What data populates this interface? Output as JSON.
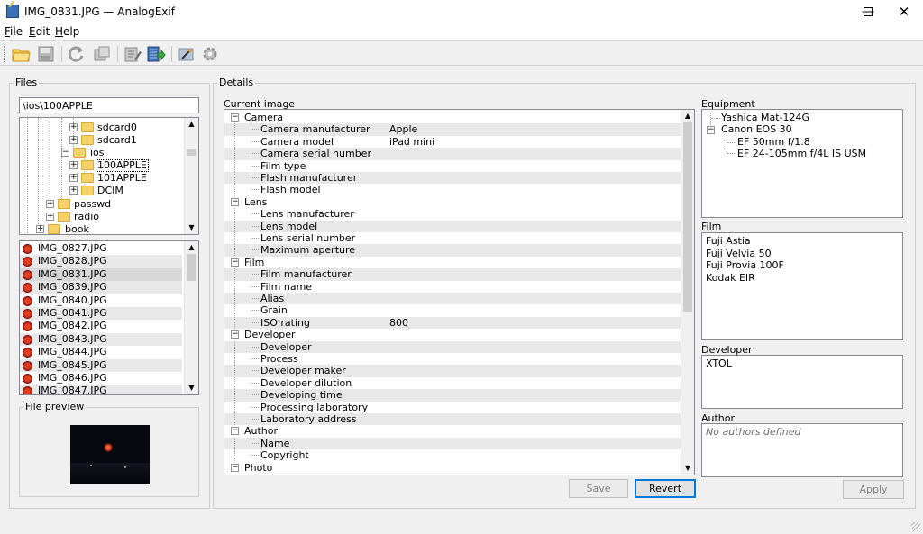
{
  "window": {
    "title": "IMG_0831.JPG — AnalogExif",
    "min_glyph": "—",
    "max_glyph": "☐",
    "close_glyph": "✕"
  },
  "menu": [
    {
      "label": "File",
      "accel": "F",
      "rest": "ile"
    },
    {
      "label": "Edit",
      "accel": "E",
      "rest": "dit"
    },
    {
      "label": "Help",
      "accel": "H",
      "rest": "elp"
    }
  ],
  "toolbar": {
    "icons": [
      "open-folder-icon",
      "save-icon",
      "reload-icon",
      "revert-icon",
      "edit-tags-icon",
      "copy-to-files-icon",
      "gear-equipment-icon",
      "settings-icon"
    ]
  },
  "files_panel": {
    "group_label": "Files",
    "path": "\\ios\\100APPLE",
    "tree": [
      {
        "label": "sdcard0",
        "expander": "+"
      },
      {
        "label": "sdcard1",
        "expander": "+"
      },
      {
        "label": "ios",
        "expander": "−"
      },
      {
        "label": "100APPLE",
        "expander": "+"
      },
      {
        "label": "101APPLE",
        "expander": "+"
      },
      {
        "label": "DCIM",
        "expander": "+"
      },
      {
        "label": "passwd",
        "expander": "+"
      },
      {
        "label": "radio",
        "expander": "+"
      },
      {
        "label": "book",
        "expander": "+"
      }
    ],
    "files": [
      "IMG_0827.JPG",
      "IMG_0828.JPG",
      "IMG_0831.JPG",
      "IMG_0839.JPG",
      "IMG_0840.JPG",
      "IMG_0841.JPG",
      "IMG_0842.JPG",
      "IMG_0843.JPG",
      "IMG_0844.JPG",
      "IMG_0845.JPG",
      "IMG_0846.JPG",
      "IMG_0847.JPG"
    ],
    "preview_label": "File preview"
  },
  "details": {
    "group_label": "Details",
    "current_image_label": "Current image",
    "rows": [
      {
        "label": "Camera",
        "value": "",
        "section": true
      },
      {
        "label": "Camera manufacturer",
        "value": "Apple"
      },
      {
        "label": "Camera model",
        "value": "iPad mini"
      },
      {
        "label": "Camera serial number",
        "value": ""
      },
      {
        "label": "Film type",
        "value": ""
      },
      {
        "label": "Flash manufacturer",
        "value": ""
      },
      {
        "label": "Flash model",
        "value": ""
      },
      {
        "label": "Lens",
        "value": "",
        "section": true
      },
      {
        "label": "Lens manufacturer",
        "value": ""
      },
      {
        "label": "Lens model",
        "value": ""
      },
      {
        "label": "Lens serial number",
        "value": ""
      },
      {
        "label": "Maximum aperture",
        "value": ""
      },
      {
        "label": "Film",
        "value": "",
        "section": true
      },
      {
        "label": "Film manufacturer",
        "value": ""
      },
      {
        "label": "Film name",
        "value": ""
      },
      {
        "label": "Alias",
        "value": ""
      },
      {
        "label": "Grain",
        "value": ""
      },
      {
        "label": "ISO rating",
        "value": "800"
      },
      {
        "label": "Developer",
        "value": "",
        "section": true
      },
      {
        "label": "Developer",
        "value": ""
      },
      {
        "label": "Process",
        "value": ""
      },
      {
        "label": "Developer maker",
        "value": ""
      },
      {
        "label": "Developer dilution",
        "value": ""
      },
      {
        "label": "Developing time",
        "value": ""
      },
      {
        "label": "Processing laboratory",
        "value": ""
      },
      {
        "label": "Laboratory address",
        "value": ""
      },
      {
        "label": "Author",
        "value": "",
        "section": true
      },
      {
        "label": "Name",
        "value": ""
      },
      {
        "label": "Copyright",
        "value": ""
      },
      {
        "label": "Photo",
        "value": "",
        "section": true
      }
    ],
    "save_label": "Save",
    "revert_label": "Revert",
    "apply_label": "Apply"
  },
  "equipment": {
    "label": "Equipment",
    "items": [
      {
        "label": "Yashica Mat-124G",
        "level": 0,
        "expander": ""
      },
      {
        "label": "Canon EOS 30",
        "level": 0,
        "expander": "−"
      },
      {
        "label": "EF 50mm f/1.8",
        "level": 1,
        "expander": ""
      },
      {
        "label": "EF 24-105mm f/4L IS USM",
        "level": 1,
        "expander": ""
      }
    ]
  },
  "film": {
    "label": "Film",
    "items": [
      "Fuji Astia",
      "Fuji Velvia 50",
      "Fuji Provia 100F",
      "Kodak EIR"
    ]
  },
  "developer": {
    "label": "Developer",
    "items": [
      "XTOL"
    ]
  },
  "author": {
    "label": "Author",
    "placeholder": "No authors defined"
  }
}
